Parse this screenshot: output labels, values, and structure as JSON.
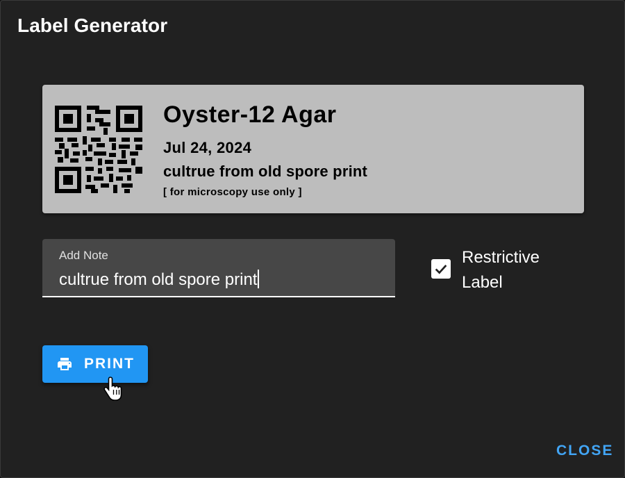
{
  "dialog": {
    "title": "Label Generator"
  },
  "label": {
    "name": "Oyster-12 Agar",
    "date": "Jul 24, 2024",
    "note": "cultrue from old spore print",
    "restriction": "[ for microscopy use only ]",
    "qr_icon": "qr-code"
  },
  "note_field": {
    "label": "Add Note",
    "value": "cultrue from old spore print"
  },
  "restrictive": {
    "label": "Restrictive Label",
    "checked": true
  },
  "actions": {
    "print_label": "PRINT",
    "print_icon": "printer",
    "close_label": "CLOSE"
  },
  "colors": {
    "dialog_bg": "#212121",
    "label_bg": "#bdbdbd",
    "primary": "#2196f3",
    "close_text": "#42a5f5"
  }
}
